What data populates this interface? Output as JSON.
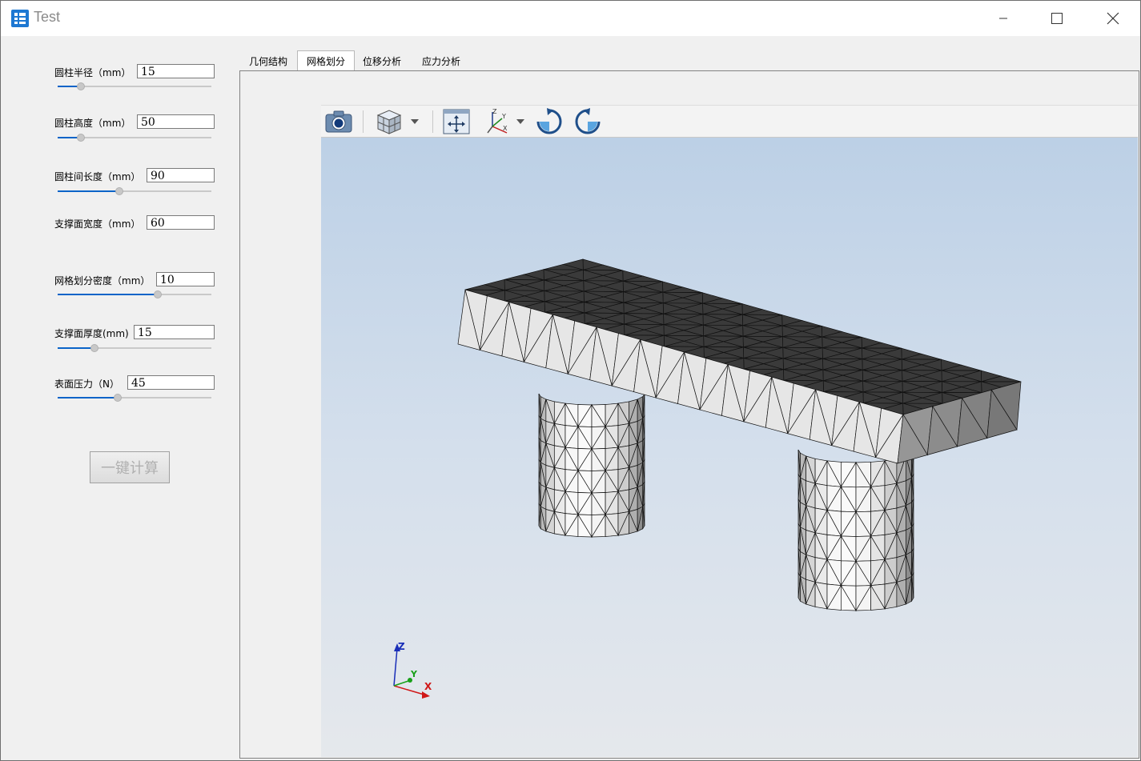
{
  "window": {
    "title": "Test",
    "controls": [
      "minimize-icon",
      "maximize-icon",
      "close-icon"
    ]
  },
  "params": [
    {
      "label": "圆柱半径（mm）",
      "value": "15",
      "slider": 0.15
    },
    {
      "label": "圆柱高度（mm）",
      "value": "50",
      "slider": 0.15
    },
    {
      "label": "圆柱间长度（mm）",
      "value": "90",
      "slider": 0.4
    },
    {
      "label": "支撑面宽度（mm）",
      "value": "60"
    },
    {
      "label": "网格划分密度（mm）",
      "value": "10",
      "slider": 0.65
    },
    {
      "label": "支撑面厚度(mm)",
      "value": "15",
      "slider": 0.24
    },
    {
      "label": "表面压力（N）",
      "value": "45",
      "slider": 0.39
    }
  ],
  "actions": {
    "calculate": "一键计算"
  },
  "tabs": [
    {
      "label": "几何结构",
      "active": false
    },
    {
      "label": "网格划分",
      "active": true
    },
    {
      "label": "位移分析",
      "active": false
    },
    {
      "label": "应力分析",
      "active": false
    }
  ],
  "viewer_toolbar": {
    "icons": [
      "camera-icon",
      "view-cube-icon",
      "dropdown-arrow-icon",
      "fit-all-icon",
      "axes-icon",
      "dropdown-arrow-icon",
      "rotate-clockwise-icon",
      "rotate-counterclockwise-icon"
    ],
    "axes_icon_labels": {
      "z": "Z",
      "y": "Y",
      "x": "X"
    }
  },
  "axis_triad": {
    "z": "Z",
    "y": "Y",
    "x": "X"
  },
  "colors": {
    "accent": "#0a64c8",
    "mesh_top": "#3a3a3a",
    "mesh_side": "#e6e6e6",
    "viewport_top": "#bcd0e6",
    "viewport_bottom": "#e5e8ec"
  }
}
